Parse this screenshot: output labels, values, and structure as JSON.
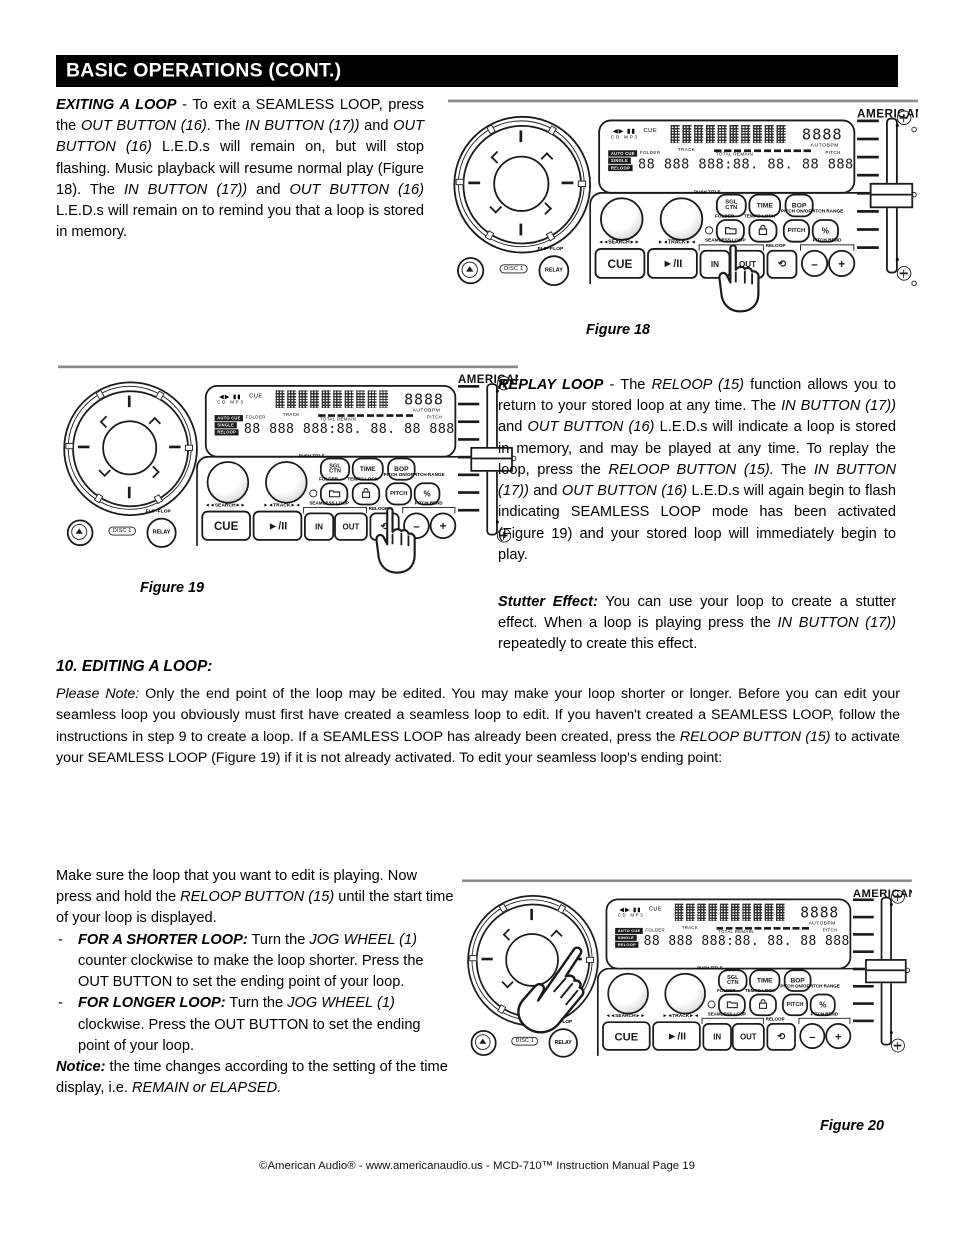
{
  "header": {
    "title": "BASIC OPERATIONS (CONT.)"
  },
  "sections": {
    "exiting": {
      "heading": "EXITING A LOOP",
      "dash": " - ",
      "t1": "To exit a SEAMLESS LOOP, press the ",
      "i1": "OUT BUTTON (16)",
      "t2": ". The ",
      "i2": "IN BUTTON (17))",
      "t3": " and ",
      "i3": "OUT BUTTON (16)",
      "t4": " L.E.D.s will remain on, but will stop flashing. Music playback will resume normal play (Figure 18). The ",
      "i4": "IN BUTTON (17))",
      "t5": " and ",
      "i5": "OUT BUTTON (16)",
      "t6": " L.E.D.s will remain on to remind you that a loop is stored in memory."
    },
    "replay": {
      "heading": "REPLAY LOOP",
      "dash": " - ",
      "t1": "The ",
      "i1": "RELOOP (15)",
      "t2": " function allows you to return to your stored loop at any time. The ",
      "i2": "IN BUTTON (17))",
      "t3": " and ",
      "i3": "OUT BUTTON (16)",
      "t4": " L.E.D.s will indicate a loop is stored in memory, and may be played at any time. To replay the loop, press the ",
      "i4": "RELOOP BUTTON (15).",
      "t5": " The ",
      "i5": "IN BUTTON (17))",
      "t6": " and ",
      "i6": "OUT BUTTON (16)",
      "t7": " L.E.D.s will again begin to flash indicating SEAMLESS LOOP mode has been activated (Figure 19) and your stored loop will immediately begin to play."
    },
    "stutter": {
      "heading": "Stutter Effect:",
      "t1": " You can use your loop to create a stutter effect. When a loop is playing press the ",
      "i1": "IN BUTTON (17))",
      "t2": " repeatedly to create this effect."
    },
    "editing": {
      "heading": "10.  EDITING A LOOP:",
      "note_label": "Please Note:",
      "note_t1": " Only the end point of the loop may be edited. You may make your loop shorter or longer. Before you can edit your seamless loop you obviously must first have created a seamless loop to edit. If you haven't created a SEAMLESS LOOP, follow the instructions in step 9 to create a loop. If a SEAMLESS LOOP has already been created, press the ",
      "note_i1": "RELOOP BUTTON (15)",
      "note_t2": " to activate your SEAMLESS LOOP (Figure 19) if it is not already activated. To edit your seamless loop's ending point:"
    },
    "steps": {
      "lead_t1": "Make sure the loop that you want to edit is playing. Now press and hold the ",
      "lead_i1": "RELOOP BUTTON (15)",
      "lead_t2": " until the start time of your loop is displayed.",
      "dash": "-",
      "item1_b": "FOR A SHORTER LOOP:",
      "item1_t1": " Turn the ",
      "item1_i1": "JOG WHEEL (1)",
      "item1_t2": " counter clockwise to make the loop shorter. Press the OUT BUTTON to set the ending point of your loop.",
      "item2_b": "FOR LONGER LOOP:",
      "item2_t1": " Turn the ",
      "item2_i1": "JOG WHEEL (1)",
      "item2_t2": " clockwise. Press the OUT BUTTON to set the ending point of your loop.",
      "notice_b": "Notice:",
      "notice_t1": " the time changes according to the setting of the time display, i.e. ",
      "notice_i1": "REMAIN or ELAPSED."
    }
  },
  "figures": {
    "fig18": {
      "caption": "Figure 18"
    },
    "fig19": {
      "caption": "Figure 19"
    },
    "fig20": {
      "caption": "Figure 20"
    }
  },
  "deck": {
    "brand": "AMERICAN",
    "lcd": {
      "play_icons": "◀▶ ▮▮",
      "cue": "CUE",
      "cd_mp3": "CD  MP3",
      "big_digits": "8888",
      "autobpm": "AUTOBPM",
      "status": [
        "AUTO CUE",
        "SINGLE",
        "RELOOP"
      ],
      "label_folder": "FOLDER",
      "label_track": "TRACK",
      "label_total": "TOTAL REMAIN",
      "label_pitch": "PITCH",
      "segments": "88 888 888:88. 88.  88 888"
    },
    "buttons": {
      "cue": "CUE",
      "play_pause": "►/II",
      "in": "IN",
      "out": "OUT",
      "reloop_icon": "⟲",
      "minus": "–",
      "plus": "+",
      "sgl_top": "SGL",
      "sgl_bottom": "CTN",
      "time": "TIME",
      "bop": "BOP",
      "folder_icon": "📁",
      "tempo_icon": "🔒",
      "pitch": "PITCH",
      "percent": "%",
      "relay": "RELAY"
    },
    "labels": {
      "search": "◄◄SEARCH►►",
      "track": "►◄TRACK►◄",
      "push_title": "PUSH TITLE",
      "folder": "FOLDER",
      "tempo_lock": "TEMPO LOCK",
      "pitch_onoff": "PITCH ON/OFF",
      "pitch_range": "PITCH RANGE",
      "seamless_loop": "SEAMLESS LOOP",
      "reloop": "RELOOP",
      "pitch_bend": "PITCH BEND",
      "flip_flop": "FLIP-FLOP",
      "disc": "DISC 1"
    }
  },
  "footer": {
    "text": "©American Audio®  -   www.americanaudio.us  -   MCD-710™ Instruction Manual Page 19"
  }
}
